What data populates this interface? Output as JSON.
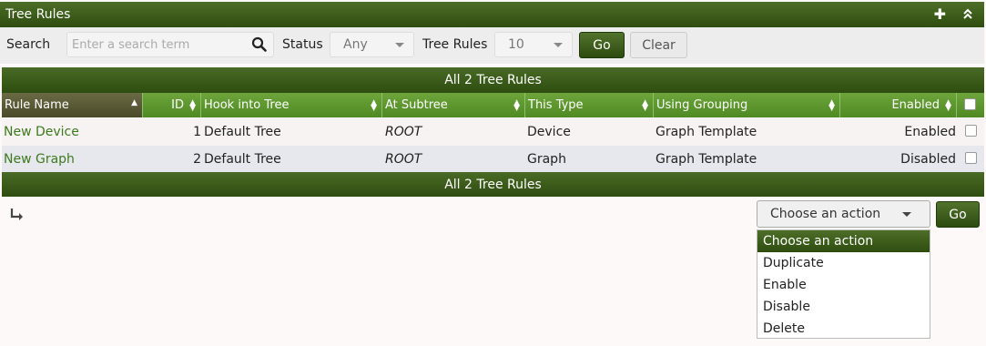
{
  "panel": {
    "title": "Tree Rules",
    "add_icon": "plus-icon",
    "collapse_icon": "double-chevron-up-icon"
  },
  "filter": {
    "search_label": "Search",
    "search_placeholder": "Enter a search term",
    "status_label": "Status",
    "status_value": "Any",
    "rows_label": "Tree Rules",
    "rows_value": "10",
    "go_label": "Go",
    "clear_label": "Clear"
  },
  "table": {
    "banner": "All 2 Tree Rules",
    "columns": [
      "Rule Name",
      "ID",
      "Hook into Tree",
      "At Subtree",
      "This Type",
      "Using Grouping",
      "Enabled"
    ],
    "rows": [
      {
        "name": "New Device",
        "id": "1",
        "tree": "Default Tree",
        "subtree": "ROOT",
        "type": "Device",
        "grouping": "Graph Template",
        "enabled": "Enabled"
      },
      {
        "name": "New Graph",
        "id": "2",
        "tree": "Default Tree",
        "subtree": "ROOT",
        "type": "Graph",
        "grouping": "Graph Template",
        "enabled": "Disabled"
      }
    ]
  },
  "actions": {
    "selected": "Choose an action",
    "go_label": "Go",
    "options": [
      "Choose an action",
      "Duplicate",
      "Enable",
      "Disable",
      "Delete"
    ]
  },
  "colors": {
    "header_dark": "#2e4d10",
    "header_green": "#5a9a2c",
    "link": "#3d7a1e"
  }
}
